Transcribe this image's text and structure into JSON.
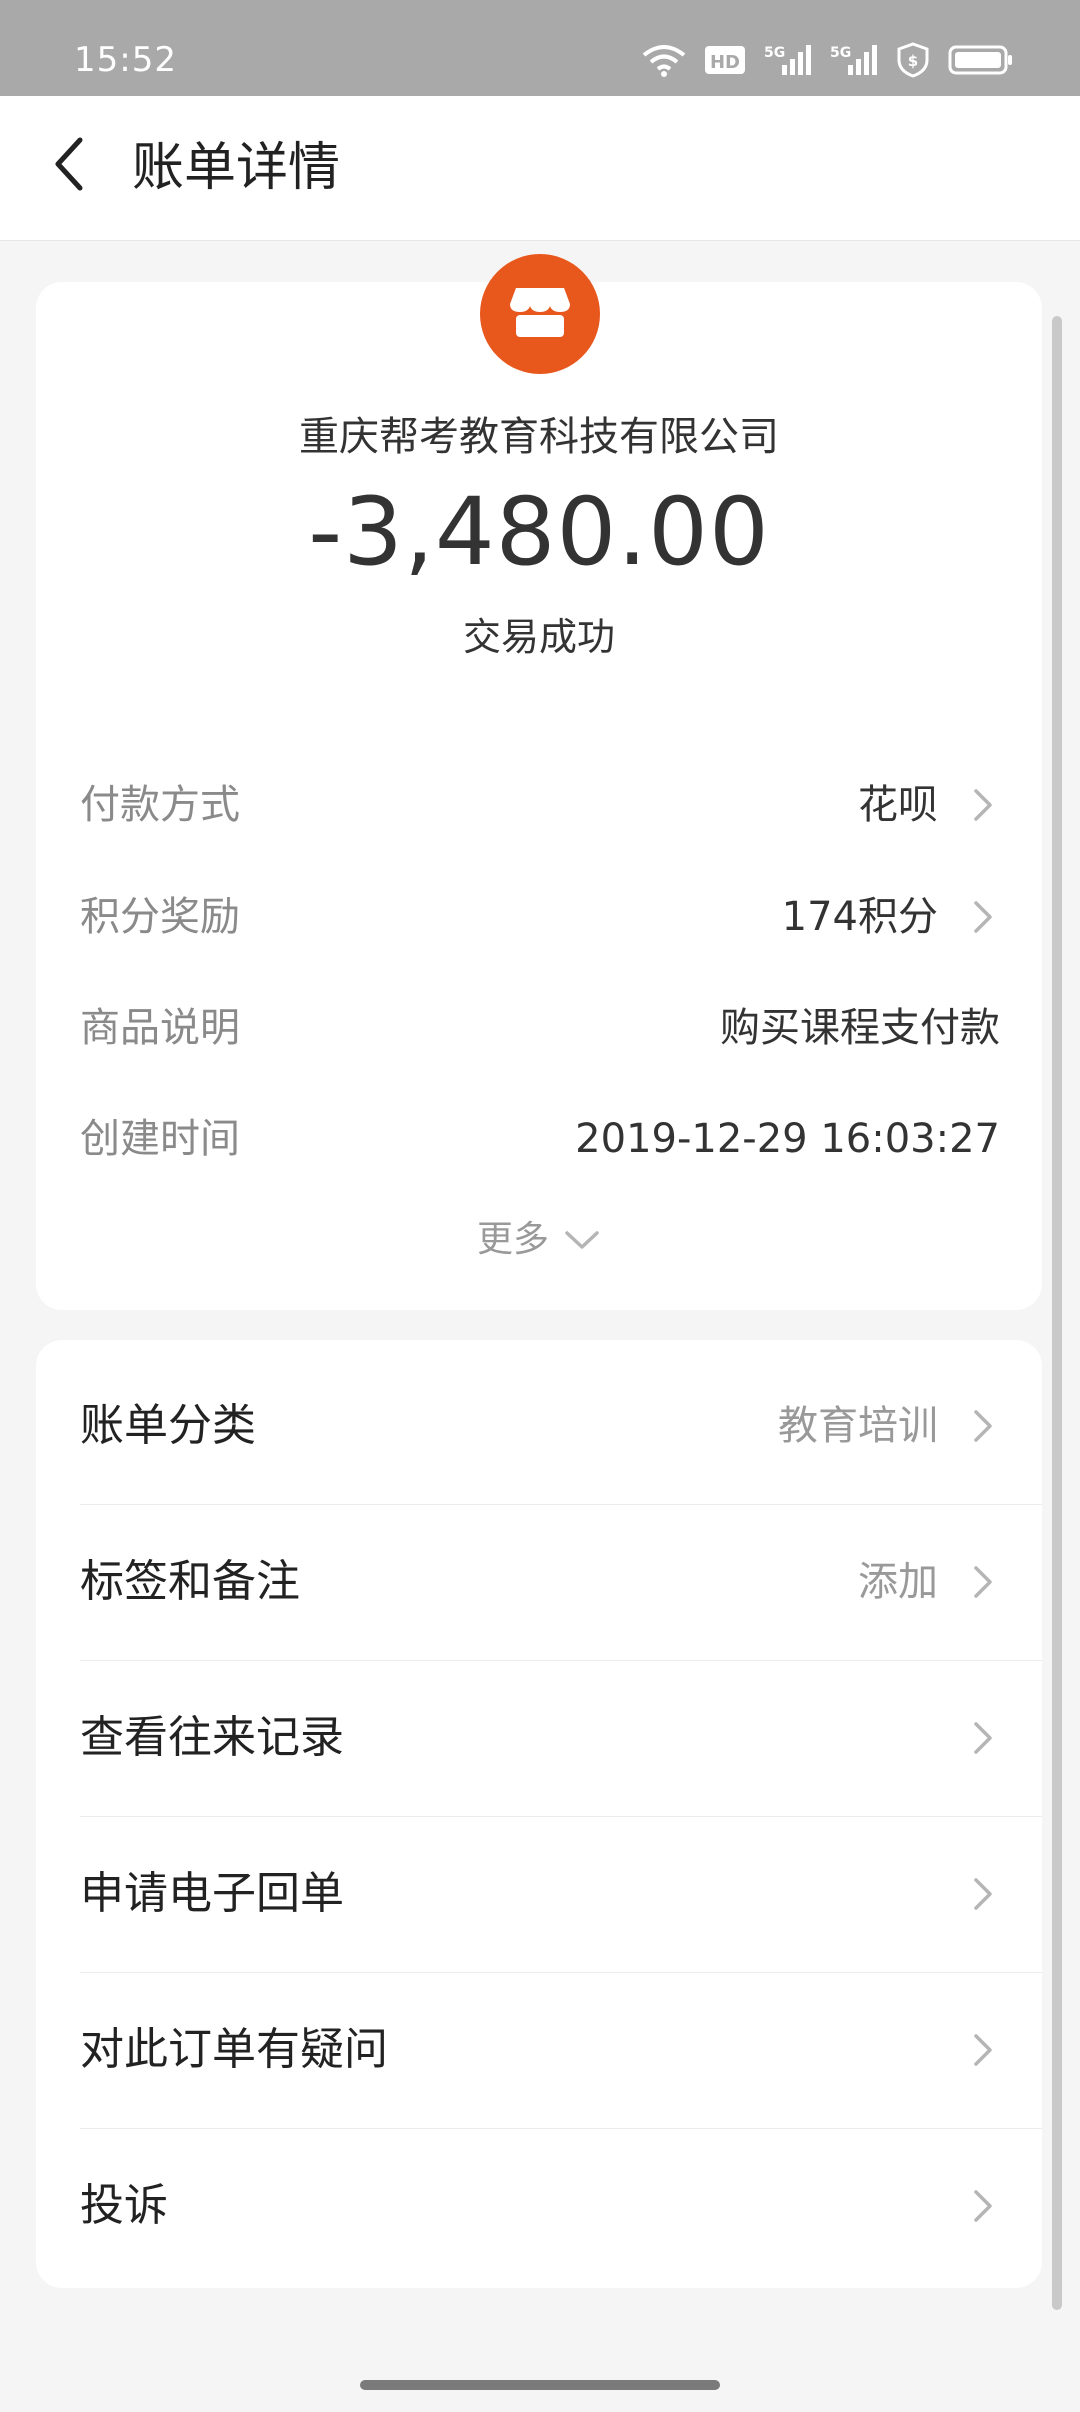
{
  "status_bar": {
    "time": "15:52",
    "icons": [
      "wifi-icon",
      "hd-icon",
      "signal-5g-icon",
      "signal-5g-icon",
      "shield-icon",
      "battery-icon"
    ],
    "hd_label": "HD",
    "network_label": "5G"
  },
  "header": {
    "title": "账单详情",
    "back_icon": "chevron-left-icon"
  },
  "summary": {
    "merchant_icon": "store-icon",
    "merchant_name": "重庆帮考教育科技有限公司",
    "amount": "-3,480.00",
    "status": "交易成功"
  },
  "details": [
    {
      "label": "付款方式",
      "value": "花呗",
      "chevron": true
    },
    {
      "label": "积分奖励",
      "value": "174积分",
      "chevron": true
    },
    {
      "label": "商品说明",
      "value": "购买课程支付款",
      "chevron": false
    },
    {
      "label": "创建时间",
      "value": "2019-12-29 16:03:27",
      "chevron": false
    }
  ],
  "more": {
    "label": "更多"
  },
  "actions": [
    {
      "label": "账单分类",
      "value": "教育培训"
    },
    {
      "label": "标签和备注",
      "value": "添加"
    },
    {
      "label": "查看往来记录",
      "value": ""
    },
    {
      "label": "申请电子回单",
      "value": ""
    },
    {
      "label": "对此订单有疑问",
      "value": ""
    },
    {
      "label": "投诉",
      "value": ""
    }
  ],
  "colors": {
    "accent": "#e8581d",
    "background": "#f5f5f5",
    "status_bar": "#a9a9a9"
  }
}
